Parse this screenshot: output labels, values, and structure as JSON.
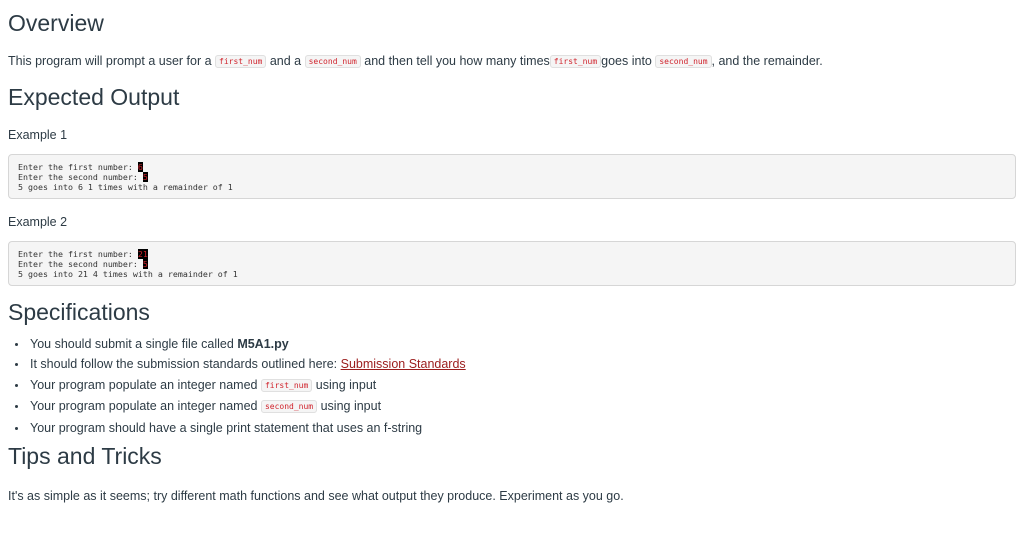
{
  "overview": {
    "heading": "Overview",
    "text_1": "This program will prompt a user for a ",
    "code_1": "first_num",
    "text_2": " and a ",
    "code_2": "second_num",
    "text_3": " and then tell you how many times",
    "code_3": "first_num",
    "text_4": "goes into ",
    "code_4": "second_num",
    "text_5": ", and the remainder."
  },
  "expected": {
    "heading": "Expected Output",
    "examples": [
      {
        "label": "Example 1",
        "prompt_1": "Enter the first number: ",
        "input_1": "6",
        "prompt_2": "Enter the second number: ",
        "input_2": "5",
        "result": "5 goes into 6 1 times with a remainder of 1"
      },
      {
        "label": "Example 2",
        "prompt_1": "Enter the first number: ",
        "input_1": "21",
        "prompt_2": "Enter the second number: ",
        "input_2": "5",
        "result": "5 goes into 21 4 times with a remainder of 1"
      }
    ]
  },
  "specs": {
    "heading": "Specifications",
    "item_1_text": "You should submit a single file called ",
    "item_1_bold": "M5A1.py",
    "item_2_text": "It should follow the submission standards outlined here: ",
    "item_2_link": "Submission Standards",
    "item_3_text": "Your program populate an integer named ",
    "item_3_code": "first_num",
    "item_3_suffix": " using input",
    "item_4_text": "Your program populate an integer named ",
    "item_4_code": "second_num",
    "item_4_suffix": " using input",
    "item_5_text": "Your program should have a single print statement that uses an f-string"
  },
  "tips": {
    "heading": "Tips and Tricks",
    "text": "It's as simple as it seems; try different math functions and see what output they produce.  Experiment as you go."
  },
  "colors": {
    "heading_text": "#2d3b45",
    "code_text": "#d0232c",
    "link": "#9b1c1c",
    "code_block_bg": "#f5f5f5"
  }
}
